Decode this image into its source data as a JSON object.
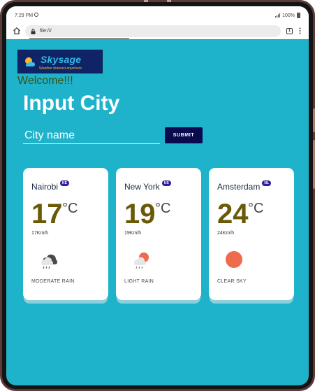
{
  "status_bar": {
    "time": "7:29 PM",
    "battery": "100%"
  },
  "browser": {
    "url": "file:///",
    "tab_count": "1"
  },
  "logo": {
    "name": "Skysage",
    "tagline": "Weather forecast anywhere"
  },
  "page": {
    "welcome": "Welcome!!!",
    "title": "Input City",
    "city_placeholder": "City name",
    "submit_label": "SUBMIT"
  },
  "cards": [
    {
      "city": "Nairobi",
      "country": "KE",
      "temp": "17",
      "unit": "°C",
      "wind": "17Km/h",
      "condition": "MODERATE RAIN",
      "icon": "cloud-rain-icon"
    },
    {
      "city": "New York",
      "country": "US",
      "temp": "19",
      "unit": "°C",
      "wind": "19Km/h",
      "condition": "LIGHT RAIN",
      "icon": "sun-cloud-rain-icon"
    },
    {
      "city": "Amsterdam",
      "country": "NL",
      "temp": "24",
      "unit": "°C",
      "wind": "24Km/h",
      "condition": "CLEAR SKY",
      "icon": "sun-icon"
    }
  ],
  "colors": {
    "page_background": "#1fb3cb",
    "submit_button": "#0a0a4f",
    "temperature": "#6a5a07",
    "country_badge": "#2d2098",
    "sun": "#ee6b4d"
  }
}
